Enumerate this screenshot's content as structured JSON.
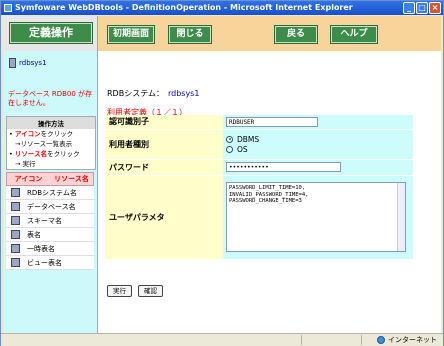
{
  "window": {
    "title": "Symfoware WebDBtools - DefinitionOperation - Microsoft Internet Explorer"
  },
  "sidebar": {
    "title": "定義操作",
    "db_name": "rdbsys1",
    "warning": "データベース RDB00 が存在しません。",
    "howto": {
      "heading": "操作方法",
      "row1_bullet": "•",
      "row1_red": "アイコン",
      "row1_text": "をクリック",
      "row2": "→リソース一覧表示",
      "row3_bullet": "•",
      "row3_red": "リソース名",
      "row3_text": "をクリック",
      "row4": "→ 実行"
    },
    "legend": {
      "col_icon": "アイコン",
      "col_name": "リソース名",
      "items": [
        {
          "label": "RDBシステム名",
          "icon": "rdb-system-icon"
        },
        {
          "label": "データベース名",
          "icon": "database-icon"
        },
        {
          "label": "スキーマ名",
          "icon": "schema-icon"
        },
        {
          "label": "表名",
          "icon": "table-icon"
        },
        {
          "label": "一時表名",
          "icon": "temp-table-icon"
        },
        {
          "label": "ビュー表名",
          "icon": "view-table-icon"
        }
      ]
    }
  },
  "toolbar": {
    "initial_screen": "初期画面",
    "close": "閉じる",
    "back": "戻る",
    "help": "ヘルプ"
  },
  "main": {
    "rdb_label": "RDBシステム：",
    "rdb_value": "rdbsys1",
    "section_title": "利用者定義（１／１）",
    "fields": {
      "auth_id_label": "認可識別子",
      "auth_id_value": "RDBUSER",
      "user_type_label": "利用者種別",
      "user_type_option1": "DBMS",
      "user_type_option2": "OS",
      "user_type_selected": "DBMS",
      "password_label": "パスワード",
      "password_value": "•••••••••••",
      "user_param_label": "ユーザパラメタ",
      "user_param_value": "PASSWORD_LIMIT_TIME=10,\nINVALID_PASSWORD_TIME=4,\nPASSWORD_CHANGE_TIME=3"
    },
    "buttons": {
      "execute": "実行",
      "confirm": "確認"
    }
  },
  "statusbar": {
    "zone": "インターネット"
  }
}
